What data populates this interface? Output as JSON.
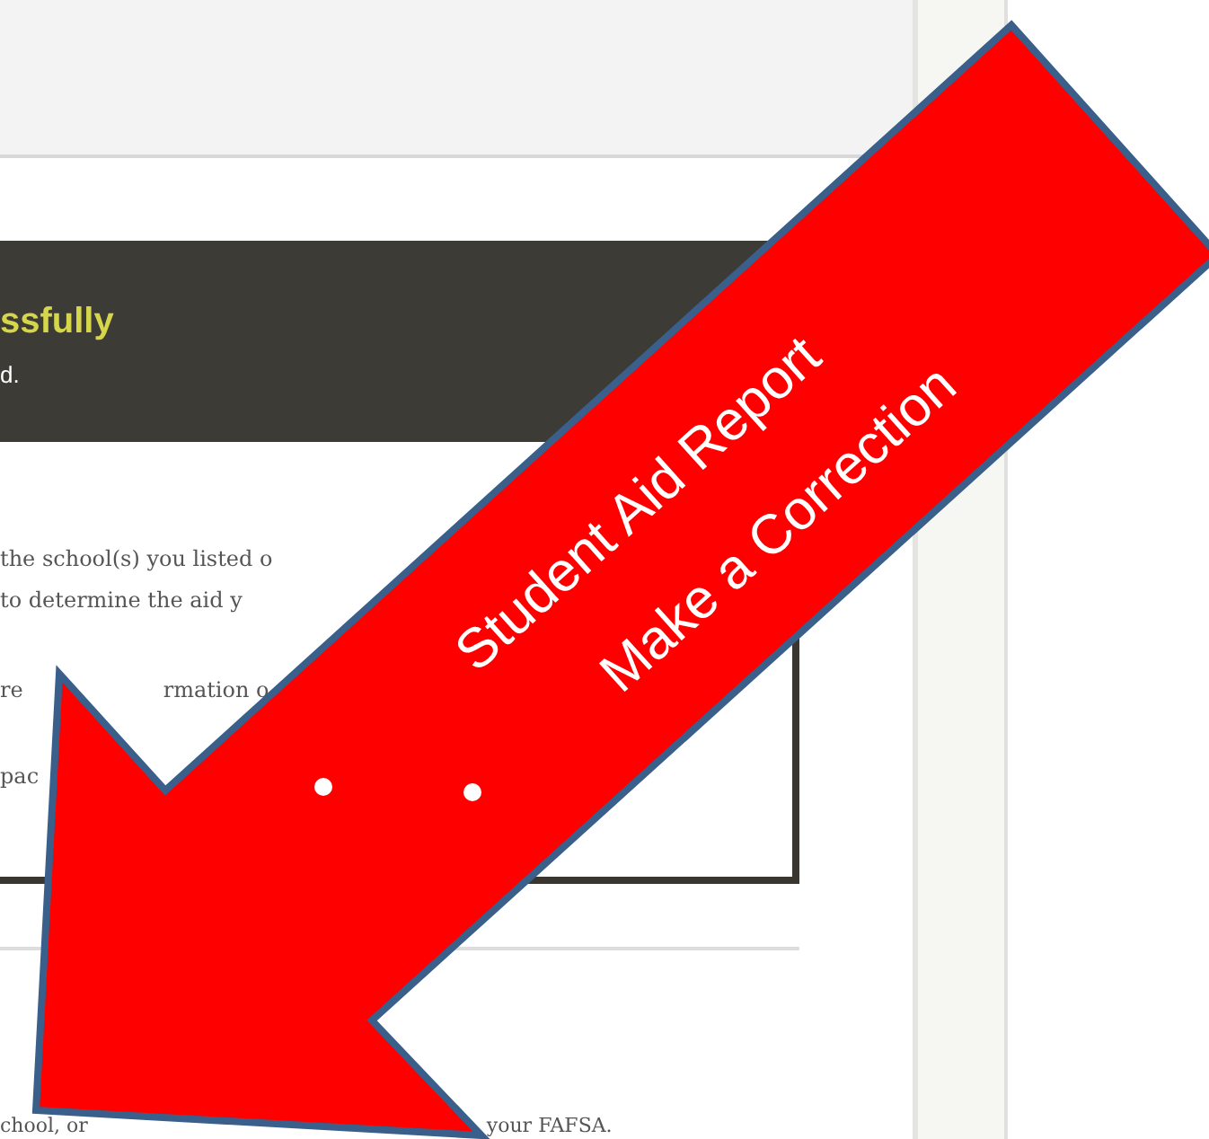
{
  "banner": {
    "title": "ssfully",
    "message": "d."
  },
  "notice_lines": [
    "the school(s) you listed o",
    "to determine the aid y",
    "re",
    "rmation o",
    "pac"
  ],
  "footer_texts": [
    "chool, or",
    "your FAFSA."
  ],
  "callout": {
    "items": [
      "Student Aid Report",
      "Make a Correction"
    ]
  }
}
